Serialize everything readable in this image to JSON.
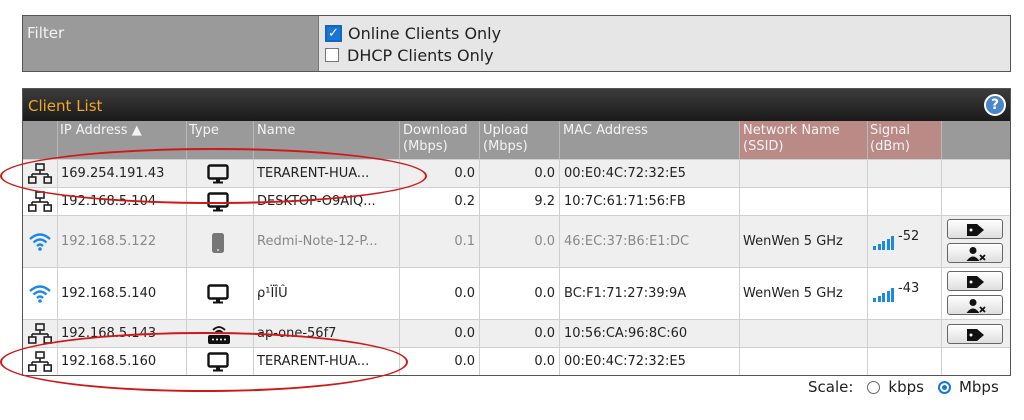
{
  "filter": {
    "label": "Filter",
    "options": [
      {
        "label": "Online Clients Only",
        "checked": true
      },
      {
        "label": "DHCP Clients Only",
        "checked": false
      }
    ]
  },
  "client_list": {
    "title": "Client List",
    "help_icon": "question-icon",
    "columns": {
      "ip": "IP Address ▲",
      "type": "Type",
      "name": "Name",
      "download": [
        "Download",
        "(Mbps)"
      ],
      "upload": [
        "Upload",
        "(Mbps)"
      ],
      "mac": "MAC Address",
      "network": [
        "Network Name",
        "(SSID)"
      ],
      "signal": [
        "Signal",
        "(dBm)"
      ]
    },
    "rows": [
      {
        "conn": "lan-icon",
        "ip": "169.254.191.43",
        "type": "desktop-icon",
        "name": "TERARENT-HUA...",
        "download": "0.0",
        "upload": "0.0",
        "mac": "00:E0:4C:72:32:E5",
        "ssid": "",
        "signal": "",
        "buttons": []
      },
      {
        "conn": "lan-icon",
        "ip": "192.168.5.104",
        "type": "desktop-icon",
        "name": "DESKTOP-O9AIQ...",
        "download": "0.2",
        "upload": "9.2",
        "mac": "10:7C:61:71:56:FB",
        "ssid": "",
        "signal": "",
        "buttons": []
      },
      {
        "conn": "wifi-icon",
        "ip": "192.168.5.122",
        "type": "phone-icon",
        "name": "Redmi-Note-12-P...",
        "download": "0.1",
        "upload": "0.0",
        "mac": "46:EC:37:B6:E1:DC",
        "ssid": "WenWen 5 GHz",
        "signal": "-52",
        "buttons": [
          "tag",
          "block-user"
        ]
      },
      {
        "conn": "wifi-icon",
        "ip": "192.168.5.140",
        "type": "desktop-icon",
        "name": "ρ¹ÏÎÛ",
        "download": "0.0",
        "upload": "0.0",
        "mac": "BC:F1:71:27:39:9A",
        "ssid": "WenWen 5 GHz",
        "signal": "-43",
        "buttons": [
          "tag",
          "block-user"
        ]
      },
      {
        "conn": "lan-icon",
        "ip": "192.168.5.143",
        "type": "router-icon",
        "name": "ap-one-56f7",
        "download": "0.0",
        "upload": "0.0",
        "mac": "10:56:CA:96:8C:60",
        "ssid": "",
        "signal": "",
        "buttons": [
          "tag"
        ]
      },
      {
        "conn": "lan-icon",
        "ip": "192.168.5.160",
        "type": "desktop-icon",
        "name": "TERARENT-HUA...",
        "download": "0.0",
        "upload": "0.0",
        "mac": "00:E0:4C:72:32:E5",
        "ssid": "",
        "signal": "",
        "buttons": []
      }
    ]
  },
  "scale": {
    "label": "Scale:",
    "options": [
      {
        "label": "kbps",
        "selected": false
      },
      {
        "label": "Mbps",
        "selected": true
      }
    ]
  },
  "colors": {
    "accent": "#f5a623",
    "header_bg": "#9a9a9a",
    "ssid_header_bg": "#b98a86",
    "signal_bar": "#1e88e5",
    "annotation": "#d01818"
  }
}
